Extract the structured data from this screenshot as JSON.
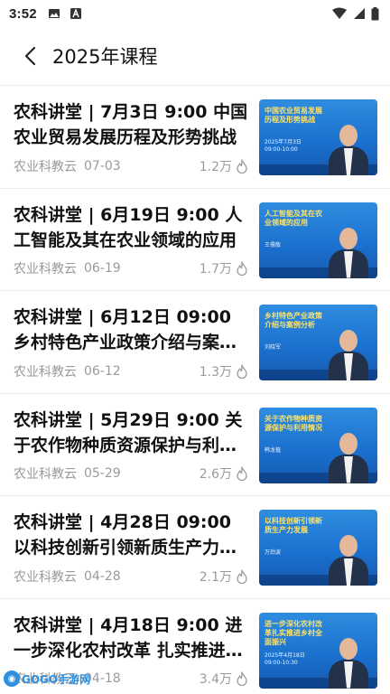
{
  "status_bar": {
    "time": "3:52"
  },
  "header": {
    "title": "2025年课程"
  },
  "items": [
    {
      "title": "农科讲堂 | 7月3日 9:00 中国农业贸易发展历程及形势挑战",
      "source": "农业科教云",
      "date": "07-03",
      "views": "1.2万",
      "thumb_tagline": "中国农业贸易发展历程及形势挑战",
      "thumb_caption": "2025年7月3日 09:00-10:00"
    },
    {
      "title": "农科讲堂 | 6月19日 9:00 人工智能及其在农业领域的应用",
      "source": "农业科教云",
      "date": "06-19",
      "views": "1.7万",
      "thumb_tagline": "人工智能及其在农业领域的应用",
      "thumb_caption": "王儒敬"
    },
    {
      "title": "农科讲堂 | 6月12日  09:00 乡村特色产业政策介绍与案例分析",
      "source": "农业科教云",
      "date": "06-12",
      "views": "1.3万",
      "thumb_tagline": "乡村特色产业政策介绍与案例分析",
      "thumb_caption": "刘晓军"
    },
    {
      "title": "农科讲堂 | 5月29日 9:00 关于农作物种质资源保护与利用情况",
      "source": "农业科教云",
      "date": "05-29",
      "views": "2.6万",
      "thumb_tagline": "关于农作物种质资源保护与利用情况",
      "thumb_caption": "韩龙植"
    },
    {
      "title": "农科讲堂 | 4月28日  09:00 以科技创新引领新质生产力发展",
      "source": "农业科教云",
      "date": "04-28",
      "views": "2.1万",
      "thumb_tagline": "以科技创新引领新质生产力发展",
      "thumb_caption": "万劲波"
    },
    {
      "title": "农科讲堂 | 4月18日 9:00 进一步深化农村改革 扎实推进乡村全面振兴",
      "source": "农业科教云",
      "date": "04-18",
      "views": "3.4万",
      "thumb_tagline": "进一步深化农村改革扎实推进乡村全面振兴",
      "thumb_caption": "2025年4月18日 09:00-10:30"
    }
  ],
  "watermark": {
    "text": "GOGO手游网"
  },
  "colors": {
    "accent": "#2e8fe0",
    "thumb_bg": "#1a6fcc",
    "meta_text": "#9a9a9a"
  },
  "icons": {
    "back": "chevron-left-icon",
    "views": "flame-icon"
  }
}
